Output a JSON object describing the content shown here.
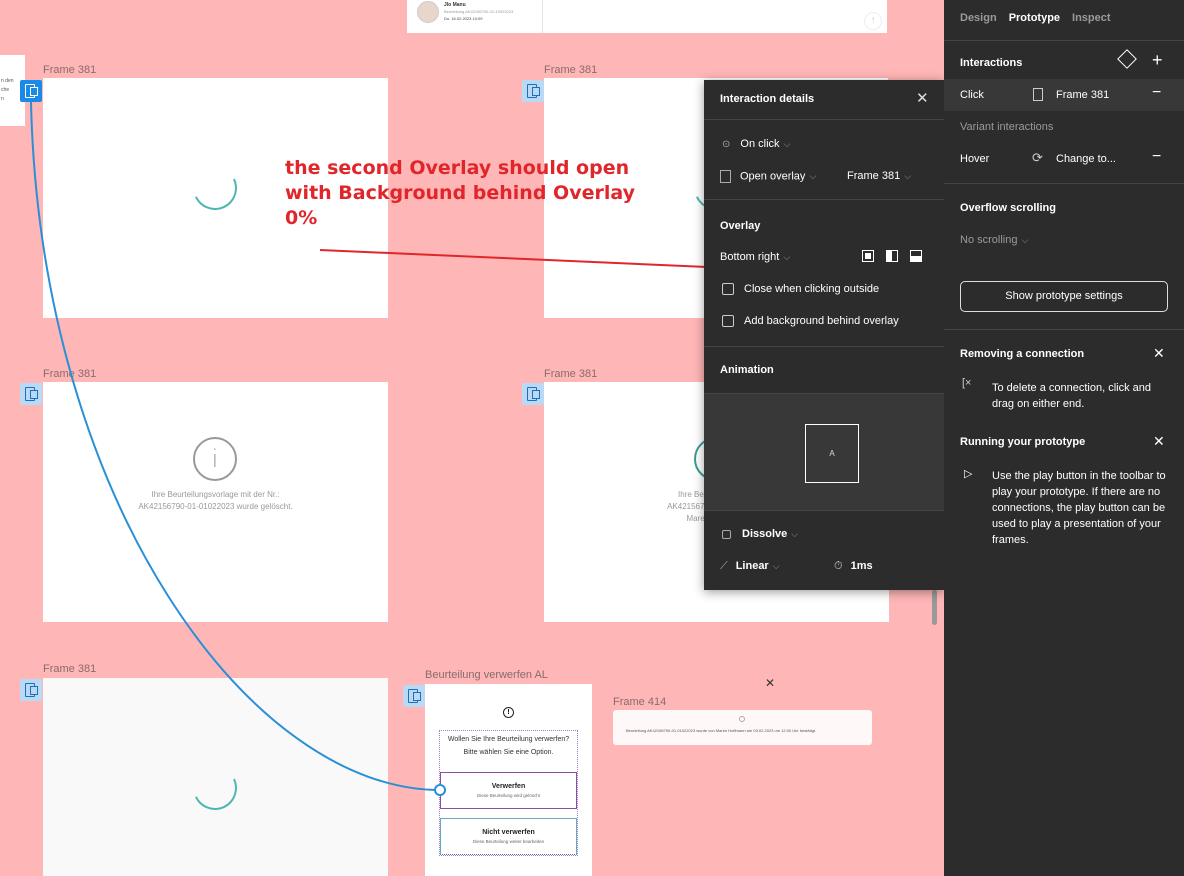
{
  "canvas": {
    "top_frame": {
      "name": "Jlo Manu",
      "line1": "Beurteilung AK42156790-01-19022023",
      "line2": "Do. 16.02.2023 10:09"
    },
    "frames": [
      {
        "label": "Frame 381",
        "type": "spinner"
      },
      {
        "label": "Frame 381",
        "type": "spinner"
      },
      {
        "label": "Frame 381",
        "type": "info",
        "text1": "Ihre Beurteilungsvorlage mit der Nr.:",
        "text2": "AK42156790-01-01022023 wurde gelöscht."
      },
      {
        "label": "Frame 381",
        "type": "info",
        "text1": "Ihre Beurteilun",
        "text2": "AK42156790-01-010",
        "text3": "Maren Ho"
      },
      {
        "label": "Frame 381",
        "type": "spinner"
      }
    ],
    "left_sliver": {
      "line1": "n den",
      "line2": "che",
      "line3": "n"
    },
    "dialog": {
      "label": "Beurteilung verwerfen AL",
      "question": "Wollen Sie Ihre Beurteilung verwerfen?",
      "hint": "Bitte wählen Sie eine Option.",
      "option1_title": "Verwerfen",
      "option1_sub": "Diese Beurteilung wird gelöscht",
      "option2_title": "Nicht verwerfen",
      "option2_sub": "Diese Beurteilung weiter bearbeiten"
    },
    "frame414": {
      "label": "Frame 414",
      "text": "Beurteilung AK42156790-01-01022023 wurde von Maren Hoffmann am 03.02.2023 um 12:00 Uhr bestätigt."
    },
    "annotation": {
      "text_line1": "the second Overlay should open",
      "text_line2": "with Background behind Overlay",
      "text_line3": "0%",
      "color": "#e0262b"
    },
    "connector_color": "#2b8fd6"
  },
  "interaction_details": {
    "title": "Interaction details",
    "trigger": "On click",
    "action": "Open overlay",
    "destination": "Frame 381",
    "overlay_heading": "Overlay",
    "position": "Bottom right",
    "close_outside_label": "Close when clicking outside",
    "close_outside_checked": false,
    "add_background_label": "Add background behind overlay",
    "add_background_checked": false,
    "animation_heading": "Animation",
    "preview_letter": "A",
    "animation_type": "Dissolve",
    "easing": "Linear",
    "duration": "1ms"
  },
  "right_panel": {
    "tabs": [
      {
        "label": "Design",
        "active": false
      },
      {
        "label": "Prototype",
        "active": true
      },
      {
        "label": "Inspect",
        "active": false
      }
    ],
    "interactions_heading": "Interactions",
    "interactions": [
      {
        "trigger": "Click",
        "target": "Frame 381"
      }
    ],
    "variant_heading": "Variant interactions",
    "variant": {
      "trigger": "Hover",
      "target": "Change to..."
    },
    "overflow_heading": "Overflow scrolling",
    "overflow_value": "No scrolling",
    "settings_button": "Show prototype settings",
    "tip1_title": "Removing a connection",
    "tip1_text": "To delete a connection, click and drag on either end.",
    "tip2_title": "Running your prototype",
    "tip2_text": "Use the play button in the toolbar to play your prototype. If there are no connections, the play button can be used to play a presentation of your frames."
  }
}
